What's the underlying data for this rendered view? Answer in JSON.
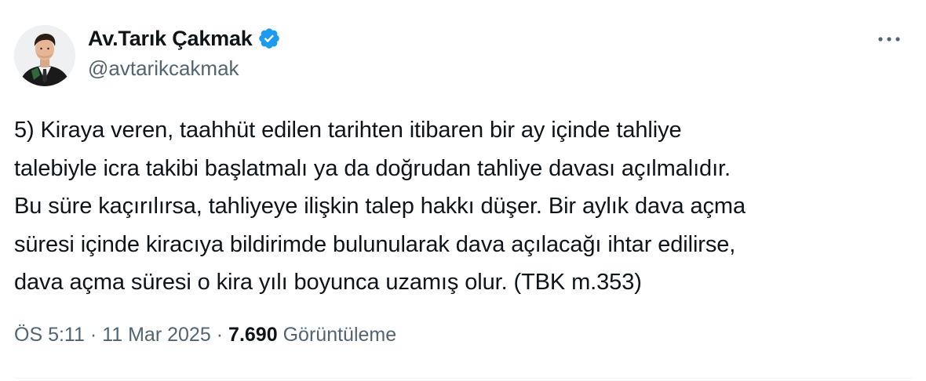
{
  "author": {
    "display_name": "Av.Tarık Çakmak",
    "handle": "@avtarikcakmak",
    "verified": true,
    "verified_color": "#1d9bf0"
  },
  "tweet": {
    "text": "5) Kiraya veren, taahhüt edilen tarihten itibaren bir ay içinde tahliye\ntalebiyle icra takibi başlatmalı ya da doğrudan tahliye davası açılmalıdır.\nBu süre kaçırılırsa, tahliyeye ilişkin talep hakkı düşer. Bir aylık dava açma\nsüresi içinde kiracıya bildirimde bulunularak dava açılacağı ihtar edilirse,\ndava açma süresi o kira yılı boyunca uzamış olur. (TBK m.353)"
  },
  "meta": {
    "time": "ÖS 5:11",
    "separator": "·",
    "date": "11 Mar 2025",
    "views_count": "7.690",
    "views_label": "Görüntüleme"
  },
  "icons": {
    "more": "more-horizontal-icon",
    "verified": "verified-badge-icon",
    "avatar": "profile-avatar"
  },
  "colors": {
    "text_primary": "#0f1419",
    "text_secondary": "#536471",
    "divider": "#eff3f4"
  }
}
